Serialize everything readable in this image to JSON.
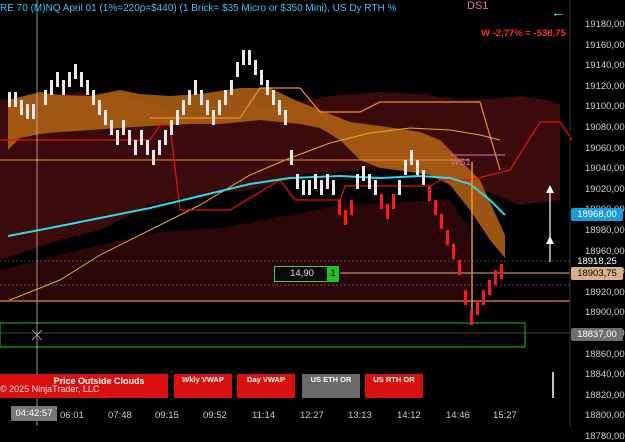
{
  "header": {
    "title": "RE 70 (M)NQ April 01 (1%=220p=$440) (1 Brick= $35 Micro or $350 Mini), US Dy RTH %",
    "ds_label": "DS1",
    "pnl": "W -2,77% = -538,75"
  },
  "y_axis": {
    "labels": [
      "19180,00",
      "19160,00",
      "19140,00",
      "19120,00",
      "19100,00",
      "19080,00",
      "19060,00",
      "19040,00",
      "19020,00",
      "19000,00",
      "18980,00",
      "18960,00",
      "18940,00",
      "18920,00",
      "18900,00",
      "18880,00",
      "18860,00",
      "18840,00",
      "18820,00",
      "18800,00",
      "18780,00"
    ],
    "tags": [
      {
        "text": "18968,00",
        "bg": "#1a9ad8",
        "fg": "#ffffff"
      },
      {
        "text": "18918,25",
        "bg": "#000000",
        "fg": "#ffffff"
      },
      {
        "text": "18903,75",
        "bg": "#d8b08c",
        "fg": "#000000"
      },
      {
        "text": "18837,00",
        "bg": "#707070",
        "fg": "#ffffff"
      }
    ]
  },
  "x_axis": {
    "current_time": "04:42:57",
    "labels": [
      "06:01",
      "07:48",
      "09:15",
      "09:52",
      "11:14",
      "12:27",
      "13:13",
      "14:12",
      "14:46",
      "15:27"
    ]
  },
  "toolbar": {
    "big_button": "Price Outside Clouds",
    "copyright": "© 2025 NinjaTrader, LLC",
    "buttons": [
      {
        "label": "Wkly VWAP",
        "color": "#d81010"
      },
      {
        "label": "Day VWAP",
        "color": "#d81010"
      },
      {
        "label": "US ETH OR",
        "color": "#6a6a6a"
      },
      {
        "label": "US RTH OR",
        "color": "#d81010"
      }
    ]
  },
  "overlay": {
    "value_box": "14,90",
    "count_box": "1",
    "ws_label": "WS1"
  },
  "colors": {
    "up_bar": "#e8e8e8",
    "down_bar": "#ff1a1a",
    "vwap": "#30d8e8",
    "cloud": "#c8781c",
    "red_line": "#e01010"
  }
}
